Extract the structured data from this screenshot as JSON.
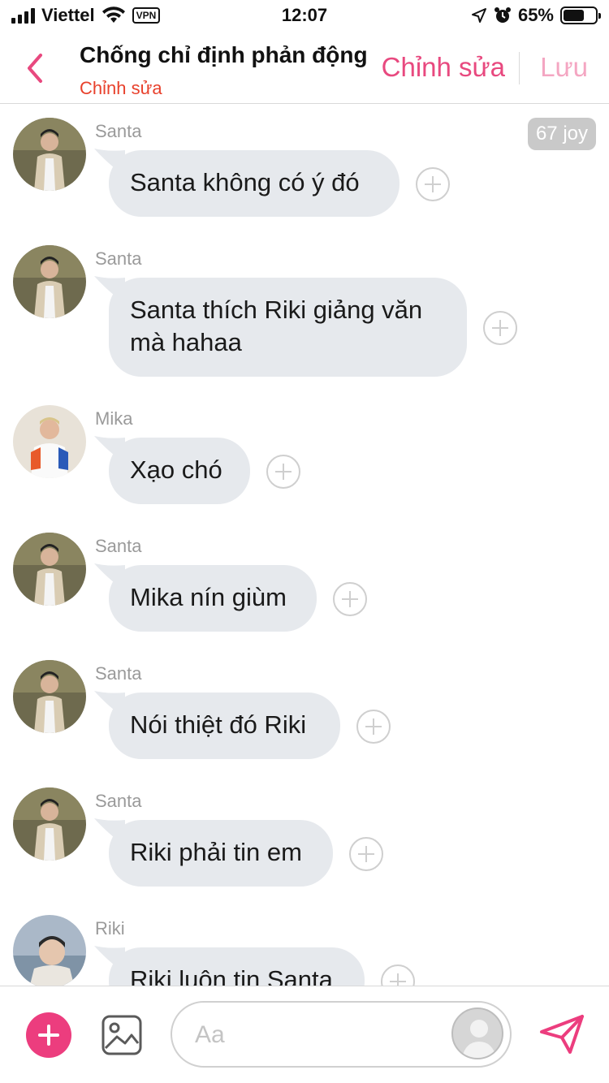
{
  "status_bar": {
    "carrier": "Viettel",
    "vpn": "VPN",
    "time": "12:07",
    "battery_percent": "65%",
    "battery_level": 0.65
  },
  "header": {
    "title": "Chống chỉ định phản động",
    "subtitle": "Chỉnh sửa",
    "edit_label": "Chỉnh sửa",
    "save_label": "Lưu"
  },
  "joy_badge": "67 joy",
  "messages": [
    {
      "sender": "Santa",
      "text": "Santa không có ý đó"
    },
    {
      "sender": "Santa",
      "text": "Santa thích Riki giảng văn mà hahaa"
    },
    {
      "sender": "Mika",
      "text": "Xạo chó"
    },
    {
      "sender": "Santa",
      "text": "Mika nín giùm"
    },
    {
      "sender": "Santa",
      "text": "Nói thiệt đó Riki"
    },
    {
      "sender": "Santa",
      "text": "Riki phải tin em"
    },
    {
      "sender": "Riki",
      "text": "Riki luôn tin Santa"
    }
  ],
  "composer": {
    "placeholder": "Aa"
  },
  "colors": {
    "accent_pink": "#ec3d7e",
    "subtitle_red": "#e8412c",
    "bubble_bg": "#e6e9ed"
  }
}
